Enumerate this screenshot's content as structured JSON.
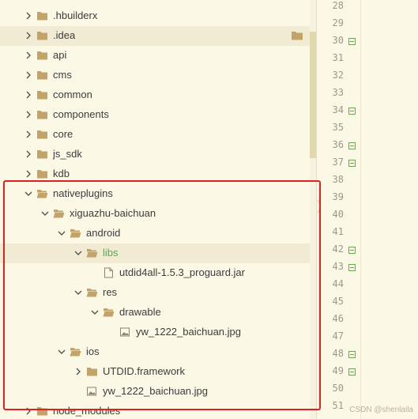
{
  "tree": {
    "items": [
      {
        "label": ".hbuilderx",
        "depth": 0,
        "type": "folder",
        "expanded": false
      },
      {
        "label": ".idea",
        "depth": 0,
        "type": "folder",
        "expanded": false,
        "hover": true
      },
      {
        "label": "api",
        "depth": 0,
        "type": "folder",
        "expanded": false
      },
      {
        "label": "cms",
        "depth": 0,
        "type": "folder",
        "expanded": false
      },
      {
        "label": "common",
        "depth": 0,
        "type": "folder",
        "expanded": false
      },
      {
        "label": "components",
        "depth": 0,
        "type": "folder",
        "expanded": false
      },
      {
        "label": "core",
        "depth": 0,
        "type": "folder",
        "expanded": false
      },
      {
        "label": "js_sdk",
        "depth": 0,
        "type": "folder",
        "expanded": false
      },
      {
        "label": "kdb",
        "depth": 0,
        "type": "folder",
        "expanded": false
      },
      {
        "label": "nativeplugins",
        "depth": 0,
        "type": "folder",
        "expanded": true
      },
      {
        "label": "xiguazhu-baichuan",
        "depth": 1,
        "type": "folder",
        "expanded": true
      },
      {
        "label": "android",
        "depth": 2,
        "type": "folder",
        "expanded": true
      },
      {
        "label": "libs",
        "depth": 3,
        "type": "folder",
        "expanded": true,
        "selected": true
      },
      {
        "label": "utdid4all-1.5.3_proguard.jar",
        "depth": 4,
        "type": "file"
      },
      {
        "label": "res",
        "depth": 3,
        "type": "folder",
        "expanded": true
      },
      {
        "label": "drawable",
        "depth": 4,
        "type": "folder",
        "expanded": true
      },
      {
        "label": "yw_1222_baichuan.jpg",
        "depth": 5,
        "type": "image"
      },
      {
        "label": "ios",
        "depth": 2,
        "type": "folder",
        "expanded": true
      },
      {
        "label": "UTDID.framework",
        "depth": 3,
        "type": "folder",
        "expanded": false
      },
      {
        "label": "yw_1222_baichuan.jpg",
        "depth": 3,
        "type": "image"
      },
      {
        "label": "node_modules",
        "depth": 0,
        "type": "folder",
        "expanded": false
      }
    ]
  },
  "editor": {
    "line_numbers": [
      {
        "n": "28",
        "fold": false
      },
      {
        "n": "29",
        "fold": false
      },
      {
        "n": "30",
        "fold": true
      },
      {
        "n": "31",
        "fold": false
      },
      {
        "n": "32",
        "fold": false
      },
      {
        "n": "33",
        "fold": false
      },
      {
        "n": "34",
        "fold": true
      },
      {
        "n": "35",
        "fold": false
      },
      {
        "n": "36",
        "fold": true
      },
      {
        "n": "37",
        "fold": true
      },
      {
        "n": "38",
        "fold": false
      },
      {
        "n": "39",
        "fold": false
      },
      {
        "n": "40",
        "fold": false
      },
      {
        "n": "41",
        "fold": false
      },
      {
        "n": "42",
        "fold": true
      },
      {
        "n": "43",
        "fold": true
      },
      {
        "n": "44",
        "fold": false
      },
      {
        "n": "45",
        "fold": false
      },
      {
        "n": "46",
        "fold": false
      },
      {
        "n": "47",
        "fold": false
      },
      {
        "n": "48",
        "fold": true
      },
      {
        "n": "49",
        "fold": true
      },
      {
        "n": "50",
        "fold": false
      },
      {
        "n": "51",
        "fold": false
      }
    ]
  },
  "watermark": "CSDN @shenlaila",
  "colors": {
    "background": "#fbf8e6",
    "folder": "#c2a46a",
    "selected_text": "#4caf50",
    "highlight_box": "#e02020",
    "fold_marker": "#6aa84f"
  }
}
